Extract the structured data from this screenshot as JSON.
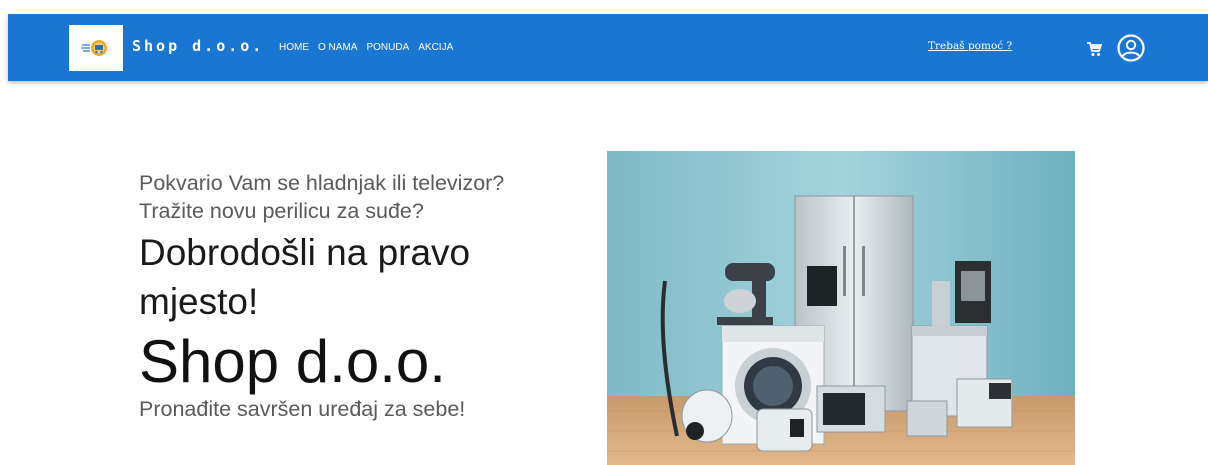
{
  "header": {
    "brand": "Shop d.o.o.",
    "nav": [
      "HOME",
      "O NAMA",
      "PONUDA",
      "AKCIJA"
    ],
    "help_link": "Trebaš pomoć ?",
    "icons": {
      "logo": "shop-logo-icon",
      "cart": "cart-icon",
      "account": "account-icon"
    },
    "bar_color": "#1976d2"
  },
  "hero": {
    "line1": "Pokvario Vam se hladnjak ili televizor?",
    "line2": "Tražite novu perilicu za suđe?",
    "welcome": "Dobrodošli na pravo mjesto!",
    "company": "Shop d.o.o.",
    "tagline": "Pronađite savršen uređaj za sebe!"
  }
}
